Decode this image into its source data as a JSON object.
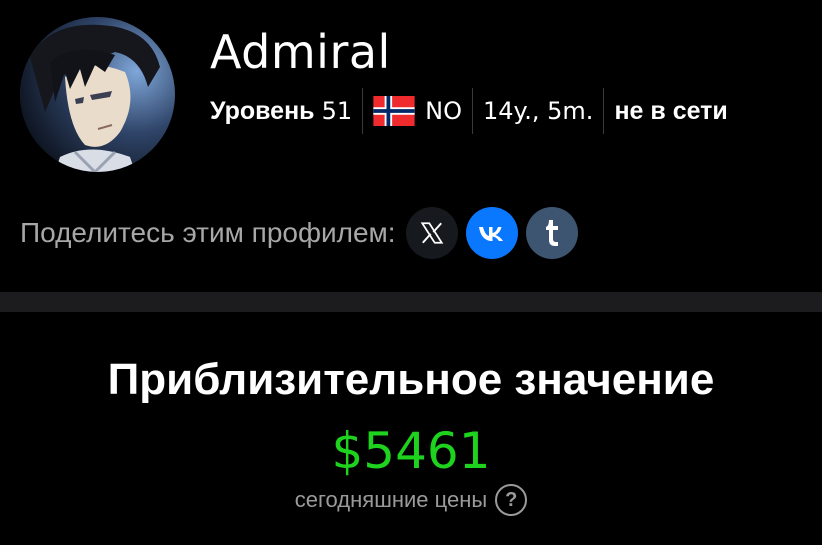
{
  "profile": {
    "username": "Admiral",
    "level_label": "Уровень",
    "level_value": "51",
    "country_code": "NO",
    "account_age": "14y., 5m.",
    "status": "не в сети",
    "avatar_icon": "anime-character-avatar",
    "flag_icon": "norway-flag-icon"
  },
  "share": {
    "label": "Поделитесь этим профилем:",
    "buttons": [
      {
        "name": "x-share-button",
        "icon": "x-logo-icon",
        "glyph": "𝕏",
        "color": "#161a1f"
      },
      {
        "name": "vk-share-button",
        "icon": "vk-logo-icon",
        "glyph": "vk",
        "color": "#0a77ff"
      },
      {
        "name": "tumblr-share-button",
        "icon": "tumblr-logo-icon",
        "glyph": "t",
        "color": "#3e5571"
      }
    ]
  },
  "valuation": {
    "title": "Приблизительное значение",
    "amount": "$5461",
    "note": "сегодняшние цены",
    "help_glyph": "?",
    "amount_color": "#1ed31e"
  },
  "colors": {
    "background": "#000000",
    "divider": "#1c1c1f",
    "muted_text": "#a7a7a7"
  }
}
